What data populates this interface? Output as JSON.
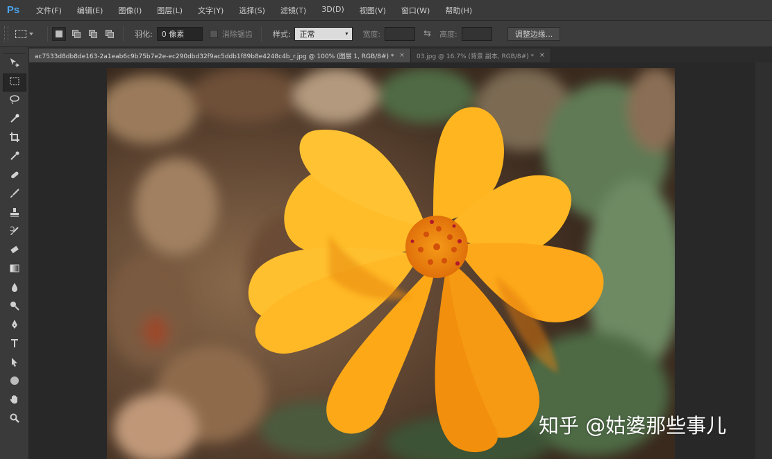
{
  "app": {
    "logo": "Ps"
  },
  "menubar": {
    "items": [
      "文件(F)",
      "编辑(E)",
      "图像(I)",
      "图层(L)",
      "文字(Y)",
      "选择(S)",
      "滤镜(T)",
      "3D(D)",
      "视图(V)",
      "窗口(W)",
      "帮助(H)"
    ]
  },
  "options": {
    "feather_label": "羽化:",
    "feather_value": "0 像素",
    "antialias_label": "消除锯齿",
    "style_label": "样式:",
    "style_value": "正常",
    "width_label": "宽度:",
    "height_label": "高度:",
    "refine_edge_label": "调整边缘..."
  },
  "tabs": [
    {
      "title": "ac7533d8db8de163-2a1eab6c9b75b7e2e-ec290dbd32f9ac5ddb1f89b8e4248c4b_r.jpg @ 100% (图层 1, RGB/8#) *",
      "close": "×",
      "active": true
    },
    {
      "title": "03.jpg @ 16.7% (背景 副本, RGB/8#) *",
      "close": "×",
      "active": false
    }
  ],
  "toolbar": {
    "tools": [
      {
        "name": "move-tool",
        "glyph": "move-icon"
      },
      {
        "name": "rect-marquee-tool",
        "glyph": "marquee-icon",
        "active": true
      },
      {
        "name": "lasso-tool",
        "glyph": "lasso-icon"
      },
      {
        "name": "quick-selection-tool",
        "glyph": "wand-icon"
      },
      {
        "name": "crop-tool",
        "glyph": "crop-icon"
      },
      {
        "name": "eyedropper-tool",
        "glyph": "eyedropper-icon"
      },
      {
        "name": "healing-brush-tool",
        "glyph": "bandage-icon"
      },
      {
        "name": "brush-tool",
        "glyph": "brush-icon"
      },
      {
        "name": "clone-stamp-tool",
        "glyph": "stamp-icon"
      },
      {
        "name": "history-brush-tool",
        "glyph": "history-brush-icon"
      },
      {
        "name": "eraser-tool",
        "glyph": "eraser-icon"
      },
      {
        "name": "gradient-tool",
        "glyph": "gradient-icon"
      },
      {
        "name": "blur-tool",
        "glyph": "drop-icon"
      },
      {
        "name": "dodge-tool",
        "glyph": "dodge-icon"
      },
      {
        "name": "pen-tool",
        "glyph": "pen-icon"
      },
      {
        "name": "type-tool",
        "glyph": "type-icon"
      },
      {
        "name": "path-selection-tool",
        "glyph": "arrow-icon"
      },
      {
        "name": "shape-tool",
        "glyph": "ellipse-icon"
      },
      {
        "name": "hand-tool",
        "glyph": "hand-icon"
      },
      {
        "name": "zoom-tool",
        "glyph": "zoom-icon"
      }
    ]
  },
  "watermark": {
    "text": "知乎 @姑婆那些事儿"
  },
  "colors": {
    "petal": "#f7a81c",
    "petal_light": "#ffc534",
    "petal_dark": "#e27c08",
    "center": "#d8620a"
  }
}
